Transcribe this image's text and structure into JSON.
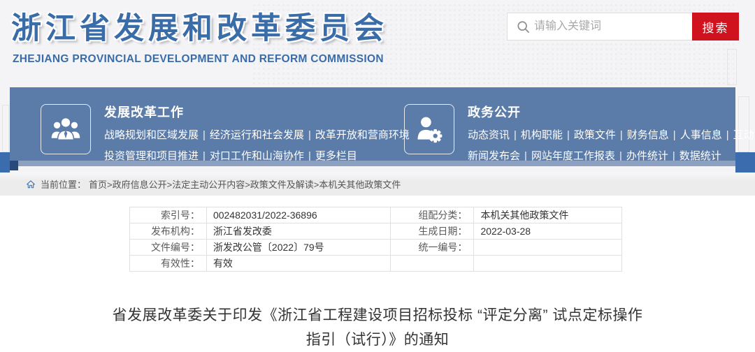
{
  "header": {
    "site_title": "浙江省发展和改革委员会",
    "site_subtitle": "ZHEJIANG PROVINCIAL DEVELOPMENT AND REFORM COMMISSION",
    "search": {
      "placeholder": "请输入关键词",
      "button_label": "搜索"
    }
  },
  "nav": {
    "separator": "|",
    "sections": [
      {
        "title": "发展改革工作",
        "icon": "people-group-icon",
        "line1_links": [
          "战略规划和区域发展",
          "经济运行和社会发展",
          "改革开放和营商环境"
        ],
        "line2_links": [
          "投资管理和项目推进",
          "对口工作和山海协作",
          "更多栏目"
        ]
      },
      {
        "title": "政务公开",
        "icon": "user-gear-icon",
        "line1_links": [
          "动态资讯",
          "机构职能",
          "政策文件",
          "财务信息",
          "人事信息",
          "互动交流"
        ],
        "line2_links": [
          "新闻发布会",
          "网站年度工作报表",
          "办件统计",
          "数据统计"
        ]
      }
    ]
  },
  "breadcrumb": {
    "prefix": "当前位置：",
    "path": "首页>政府信息公开>法定主动公开内容>政策文件及解读>本机关其他政策文件"
  },
  "meta_table": {
    "rows": [
      {
        "label1": "索引号：",
        "value1": "002482031/2022-36896",
        "label2": "组配分类：",
        "value2": "本机关其他政策文件"
      },
      {
        "label1": "发布机构：",
        "value1": "浙江省发改委",
        "label2": "生成日期：",
        "value2": "2022-03-28"
      },
      {
        "label1": "文件编号：",
        "value1": "浙发改公管〔2022〕79号",
        "label2": "统一编号：",
        "value2": ""
      },
      {
        "label1": "有效性：",
        "value1": "有效",
        "label2": "",
        "value2": ""
      }
    ]
  },
  "document": {
    "title_line1": "省发展改革委关于印发《浙江省工程建设项目招标投标 “评定分离” 试点定标操作",
    "title_line2": "指引（试行）》的通知"
  },
  "colors": {
    "accent_blue": "#3a6ca8",
    "nav_panel_blue": "#5b7ba9",
    "band_blue": "#3a6cae",
    "search_red": "#d0121f",
    "breadcrumb_bg": "#ececec"
  }
}
